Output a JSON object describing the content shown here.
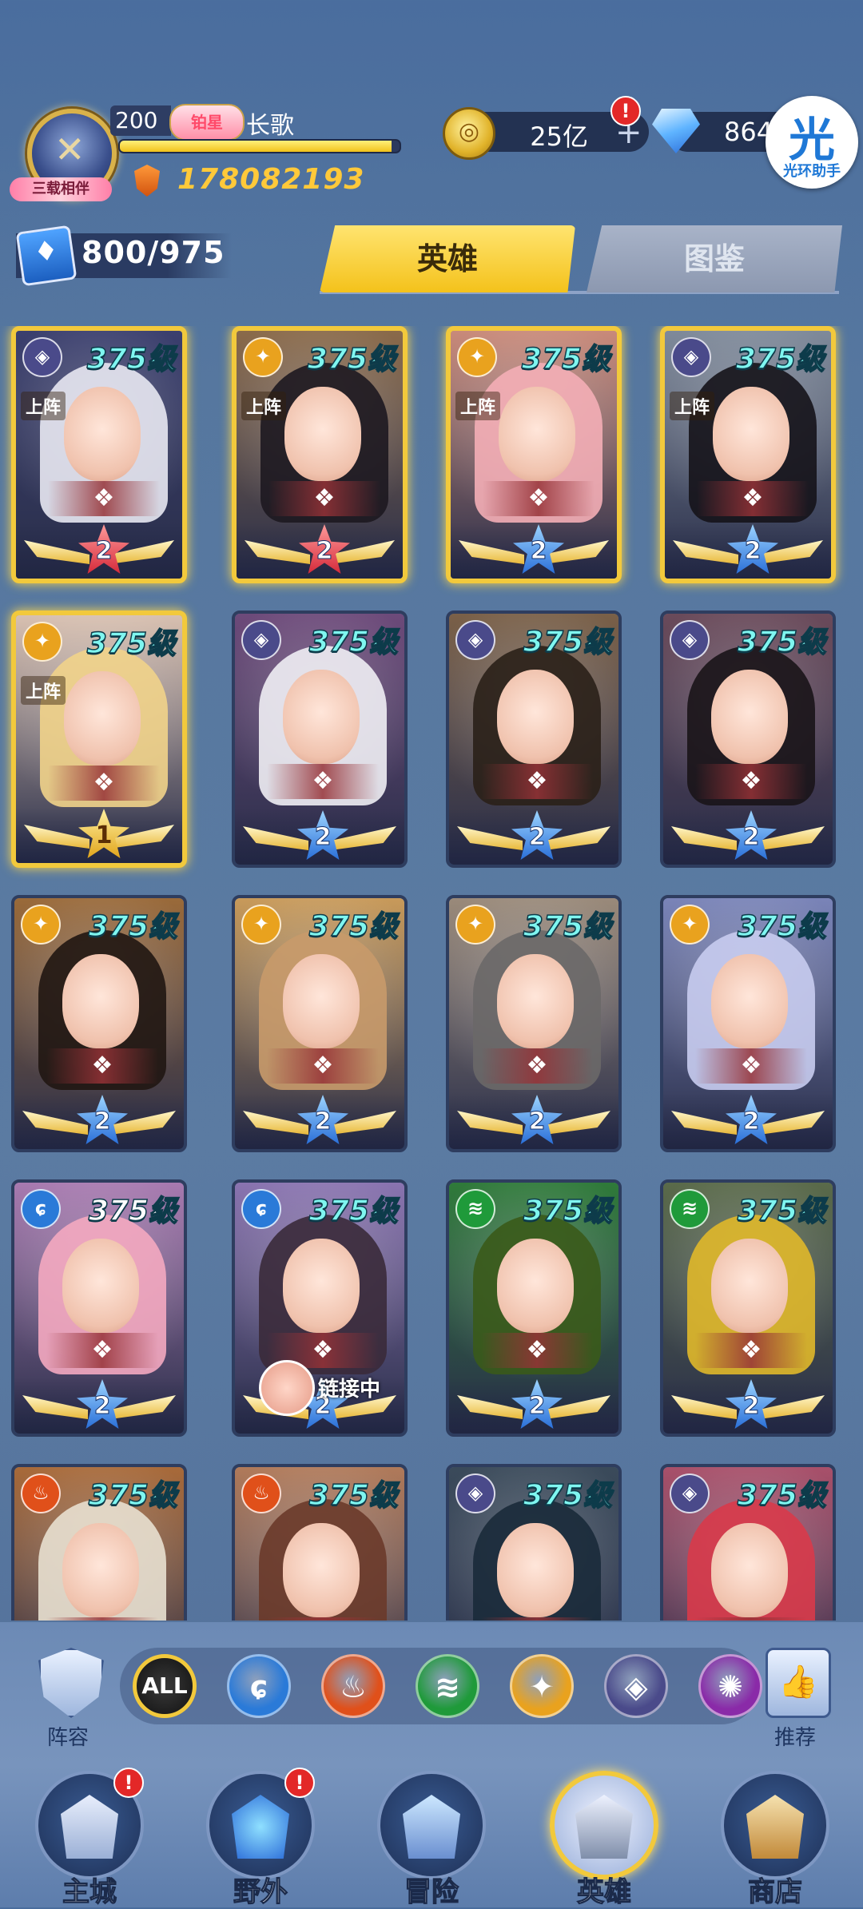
{
  "player": {
    "avatar_ribbon": "三载相伴",
    "level": "200",
    "rank_badge": "铂星",
    "name": "长歌",
    "exp_fraction": 0.97,
    "power": "178082193"
  },
  "resources": {
    "gold_icon": "gold-coin-icon",
    "gold": "25亿",
    "gold_alert": "!",
    "diamond": "864",
    "assist_glyph": "光",
    "assist_label": "光环助手"
  },
  "cards": {
    "count": "800/975"
  },
  "tabs": {
    "hero": "英雄",
    "atlas": "图鉴"
  },
  "heroes": [
    {
      "element": "void",
      "level": "375级",
      "deploy": "上阵",
      "stars": "2",
      "star_color": "red",
      "frame": "gold",
      "hair": "#e8e8f2",
      "bg": "#3b3f6e"
    },
    {
      "element": "light",
      "level": "375级",
      "deploy": "上阵",
      "stars": "2",
      "star_color": "red",
      "frame": "gold",
      "hair": "#1d1820",
      "bg": "#8a6a4a"
    },
    {
      "element": "light",
      "level": "375级",
      "deploy": "上阵",
      "stars": "2",
      "star_color": "blue",
      "frame": "gold",
      "hair": "#f4aeb6",
      "bg": "#c98a7a"
    },
    {
      "element": "void",
      "level": "375级",
      "deploy": "上阵",
      "stars": "2",
      "star_color": "blue",
      "frame": "gold",
      "hair": "#15131a",
      "bg": "#7f8a9a"
    },
    {
      "element": "light",
      "level": "375级",
      "deploy": "上阵",
      "stars": "1",
      "star_color": "gold",
      "frame": "gold",
      "hair": "#f1d38a",
      "bg": "#d8c0b0"
    },
    {
      "element": "void",
      "level": "375级",
      "deploy": "",
      "stars": "2",
      "star_color": "blue",
      "frame": "",
      "hair": "#f0eef4",
      "bg": "#6d4a7a"
    },
    {
      "element": "void",
      "level": "375级",
      "deploy": "",
      "stars": "2",
      "star_color": "blue",
      "frame": "",
      "hair": "#2a2018",
      "bg": "#7a6048"
    },
    {
      "element": "void",
      "level": "375级",
      "deploy": "",
      "stars": "2",
      "star_color": "blue",
      "frame": "",
      "hair": "#1a1418",
      "bg": "#6a4a5a"
    },
    {
      "element": "light",
      "level": "375级",
      "deploy": "",
      "stars": "2",
      "star_color": "blue",
      "frame": "",
      "hair": "#201612",
      "bg": "#9a6a3a"
    },
    {
      "element": "light",
      "level": "375级",
      "deploy": "",
      "stars": "2",
      "star_color": "blue",
      "frame": "",
      "hair": "#c89a6a",
      "bg": "#c89a5a"
    },
    {
      "element": "light",
      "level": "375级",
      "deploy": "",
      "stars": "2",
      "star_color": "blue",
      "frame": "",
      "hair": "#6a6868",
      "bg": "#9a8a7a"
    },
    {
      "element": "light",
      "level": "375级",
      "deploy": "",
      "stars": "2",
      "star_color": "blue",
      "frame": "",
      "hair": "#c8ccf0",
      "bg": "#7a84b8"
    },
    {
      "element": "water",
      "level": "375级",
      "deploy": "",
      "stars": "2",
      "star_color": "blue",
      "frame": "",
      "hair": "#f4a8c0",
      "bg": "#a87ab0",
      "level_white": true
    },
    {
      "element": "water",
      "level": "375级",
      "deploy": "",
      "stars": "2",
      "star_color": "blue",
      "frame": "",
      "hair": "#3a2a3a",
      "bg": "#8a74b0",
      "link_text": "链接中"
    },
    {
      "element": "wind",
      "level": "375级",
      "deploy": "",
      "stars": "2",
      "star_color": "blue",
      "frame": "",
      "hair": "#3a5a1a",
      "bg": "#2f7a3a"
    },
    {
      "element": "wind",
      "level": "375级",
      "deploy": "",
      "stars": "2",
      "star_color": "blue",
      "frame": "",
      "hair": "#e0b82a",
      "bg": "#5a6a4a"
    },
    {
      "element": "fire",
      "level": "375级",
      "deploy": "",
      "stars": "",
      "star_color": "blue",
      "frame": "",
      "hair": "#e8e0d0",
      "bg": "#a86a3a"
    },
    {
      "element": "fire",
      "level": "375级",
      "deploy": "",
      "stars": "",
      "star_color": "blue",
      "frame": "",
      "hair": "#6a3a2a",
      "bg": "#b07a5a"
    },
    {
      "element": "void",
      "level": "375级",
      "deploy": "",
      "stars": "",
      "star_color": "blue",
      "frame": "",
      "hair": "#1a2a3a",
      "bg": "#3a4a5a"
    },
    {
      "element": "void",
      "level": "375级",
      "deploy": "",
      "stars": "",
      "star_color": "blue",
      "frame": "",
      "hair": "#d83a4a",
      "bg": "#a8506a"
    }
  ],
  "element_colors": {
    "void": "#4a4a8a",
    "light": "#e9a21e",
    "water": "#2a7ad8",
    "wind": "#1f9a3a",
    "fire": "#e0501a",
    "dark": "#8a2aa8"
  },
  "filters": {
    "lineup_label": "阵容",
    "recommend_label": "推荐",
    "all_label": "ALL",
    "elements": [
      {
        "name": "water-element-icon",
        "color": "#2a7ad8",
        "glyph": "ɕ"
      },
      {
        "name": "fire-element-icon",
        "color": "#e0501a",
        "glyph": "♨"
      },
      {
        "name": "wind-element-icon",
        "color": "#1f9a3a",
        "glyph": "≋"
      },
      {
        "name": "light-element-icon",
        "color": "#e9a21e",
        "glyph": "✦"
      },
      {
        "name": "void-element-icon",
        "color": "#4a4a8a",
        "glyph": "◈"
      },
      {
        "name": "dark-element-icon",
        "color": "#8a2aa8",
        "glyph": "✺"
      }
    ]
  },
  "nav": {
    "items": [
      {
        "label": "主城",
        "alert": "!",
        "icon": "castle-icon"
      },
      {
        "label": "野外",
        "alert": "!",
        "icon": "portal-icon"
      },
      {
        "label": "冒险",
        "alert": "",
        "icon": "sword-icon"
      },
      {
        "label": "英雄",
        "alert": "",
        "icon": "helmet-icon",
        "active": true
      },
      {
        "label": "商店",
        "alert": "",
        "icon": "shop-icon"
      }
    ]
  }
}
